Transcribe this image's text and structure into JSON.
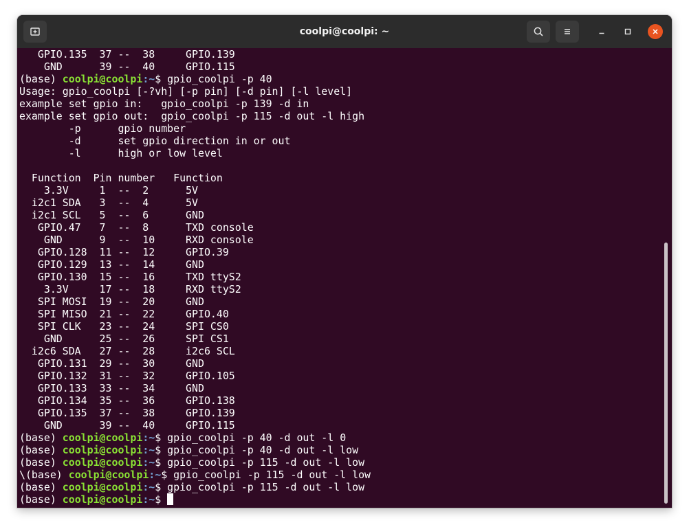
{
  "window": {
    "title": "coolpi@coolpi: ~"
  },
  "toolbar": {
    "new_tab_icon": "new-tab-icon",
    "search_icon": "search-icon",
    "menu_icon": "hamburger-menu-icon",
    "minimize_icon": "minimize-icon",
    "maximize_icon": "maximize-icon",
    "close_icon": "close-icon"
  },
  "colors": {
    "terminal_bg": "#300a24",
    "prompt_user": "#8ae234",
    "prompt_path": "#729fcf",
    "close_button": "#e95420"
  },
  "terminal": {
    "lines": [
      {
        "type": "text",
        "text": "   GPIO.135  37 --  38     GPIO.139"
      },
      {
        "type": "text",
        "text": "    GND      39 --  40     GPIO.115"
      },
      {
        "type": "prompt",
        "pre": "(base) ",
        "user": "coolpi@coolpi",
        "path": ":~",
        "cmd": "$ gpio_coolpi -p 40"
      },
      {
        "type": "text",
        "text": "Usage: gpio_coolpi [-?vh] [-p pin] [-d pin] [-l level]"
      },
      {
        "type": "text",
        "text": "example set gpio in:   gpio_coolpi -p 139 -d in"
      },
      {
        "type": "text",
        "text": "example set gpio out:  gpio_coolpi -p 115 -d out -l high"
      },
      {
        "type": "text",
        "text": "        -p      gpio number"
      },
      {
        "type": "text",
        "text": "        -d      set gpio direction in or out"
      },
      {
        "type": "text",
        "text": "        -l      high or low level"
      },
      {
        "type": "text",
        "text": ""
      },
      {
        "type": "text",
        "text": "  Function  Pin number   Function"
      },
      {
        "type": "text",
        "text": "    3.3V     1  --  2      5V"
      },
      {
        "type": "text",
        "text": "  i2c1 SDA   3  --  4      5V"
      },
      {
        "type": "text",
        "text": "  i2c1 SCL   5  --  6      GND"
      },
      {
        "type": "text",
        "text": "   GPIO.47   7  --  8      TXD console"
      },
      {
        "type": "text",
        "text": "    GND      9  --  10     RXD console"
      },
      {
        "type": "text",
        "text": "   GPIO.128  11 --  12     GPIO.39"
      },
      {
        "type": "text",
        "text": "   GPIO.129  13 --  14     GND"
      },
      {
        "type": "text",
        "text": "   GPIO.130  15 --  16     TXD ttyS2"
      },
      {
        "type": "text",
        "text": "    3.3V     17 --  18     RXD ttyS2"
      },
      {
        "type": "text",
        "text": "   SPI MOSI  19 --  20     GND"
      },
      {
        "type": "text",
        "text": "   SPI MISO  21 --  22     GPIO.40"
      },
      {
        "type": "text",
        "text": "   SPI CLK   23 --  24     SPI CS0"
      },
      {
        "type": "text",
        "text": "    GND      25 --  26     SPI CS1"
      },
      {
        "type": "text",
        "text": "  i2c6 SDA   27 --  28     i2c6 SCL"
      },
      {
        "type": "text",
        "text": "   GPIO.131  29 --  30     GND"
      },
      {
        "type": "text",
        "text": "   GPIO.132  31 --  32     GPIO.105"
      },
      {
        "type": "text",
        "text": "   GPIO.133  33 --  34     GND"
      },
      {
        "type": "text",
        "text": "   GPIO.134  35 --  36     GPIO.138"
      },
      {
        "type": "text",
        "text": "   GPIO.135  37 --  38     GPIO.139"
      },
      {
        "type": "text",
        "text": "    GND      39 --  40     GPIO.115"
      },
      {
        "type": "prompt",
        "pre": "(base) ",
        "user": "coolpi@coolpi",
        "path": ":~",
        "cmd": "$ gpio_coolpi -p 40 -d out -l 0"
      },
      {
        "type": "prompt",
        "pre": "(base) ",
        "user": "coolpi@coolpi",
        "path": ":~",
        "cmd": "$ gpio_coolpi -p 40 -d out -l low"
      },
      {
        "type": "prompt",
        "pre": "(base) ",
        "user": "coolpi@coolpi",
        "path": ":~",
        "cmd": "$ gpio_coolpi -p 115 -d out -l low"
      },
      {
        "type": "prompt",
        "pre": "\\(base) ",
        "user": "coolpi@coolpi",
        "path": ":~",
        "cmd": "$ gpio_coolpi -p 115 -d out -l low"
      },
      {
        "type": "prompt",
        "pre": "(base) ",
        "user": "coolpi@coolpi",
        "path": ":~",
        "cmd": "$ gpio_coolpi -p 115 -d out -l low"
      },
      {
        "type": "prompt",
        "pre": "(base) ",
        "user": "coolpi@coolpi",
        "path": ":~",
        "cmd": "$ ",
        "cursor": true
      }
    ]
  }
}
